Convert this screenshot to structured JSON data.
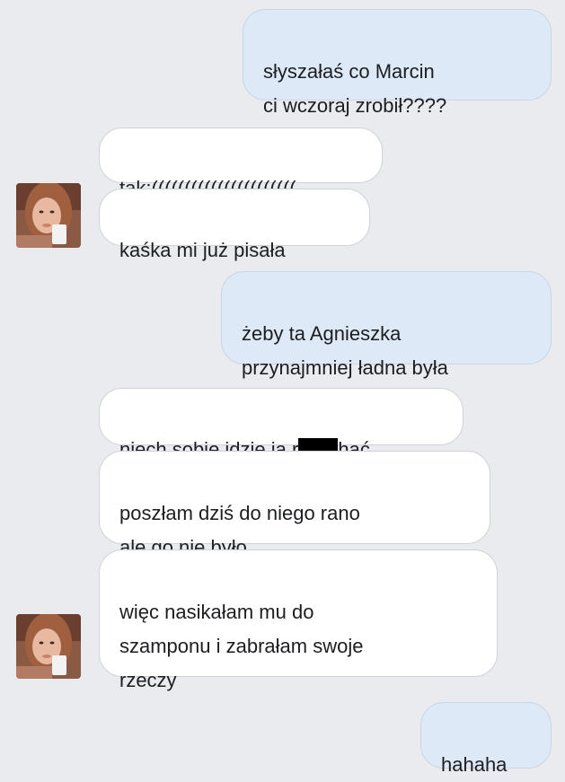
{
  "conversation": {
    "messages": [
      {
        "sender": "self",
        "text": "słyszałaś co Marcin\nci wczoraj zrobił????"
      },
      {
        "sender": "other",
        "text": "tak:(((((((((((((((((((((("
      },
      {
        "sender": "other",
        "text": "kaśka mi już pisała"
      },
      {
        "sender": "self",
        "text": "żeby ta Agnieszka\nprzynajmniej ładna była"
      },
      {
        "sender": "other",
        "text_before": "niech sobie idzie ja r",
        "text_after": "hać",
        "redacted": true
      },
      {
        "sender": "other",
        "text": "poszłam dziś do niego rano\nale go nie było"
      },
      {
        "sender": "other",
        "text": "więc nasikałam mu do\nszamponu i zabrałam swoje\nrzeczy"
      },
      {
        "sender": "self",
        "text": "hahaha"
      }
    ],
    "avatar_icon": "user-photo-icon"
  },
  "colors": {
    "background": "#e9ebee",
    "sent_bubble": "#dde9f6",
    "received_bubble": "#ffffff",
    "redaction": "#000000"
  }
}
